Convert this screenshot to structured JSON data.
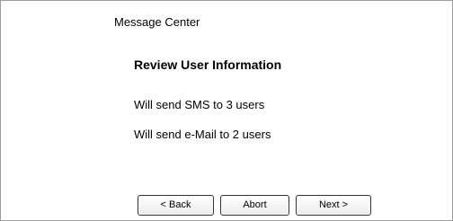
{
  "window": {
    "title": "Message Center"
  },
  "main": {
    "heading": "Review User Information",
    "messages": [
      "Will send SMS to 3 users",
      "Will send e-Mail to 2 users"
    ]
  },
  "buttons": {
    "back_label": "< Back",
    "abort_label": "Abort",
    "next_label": "Next >"
  }
}
